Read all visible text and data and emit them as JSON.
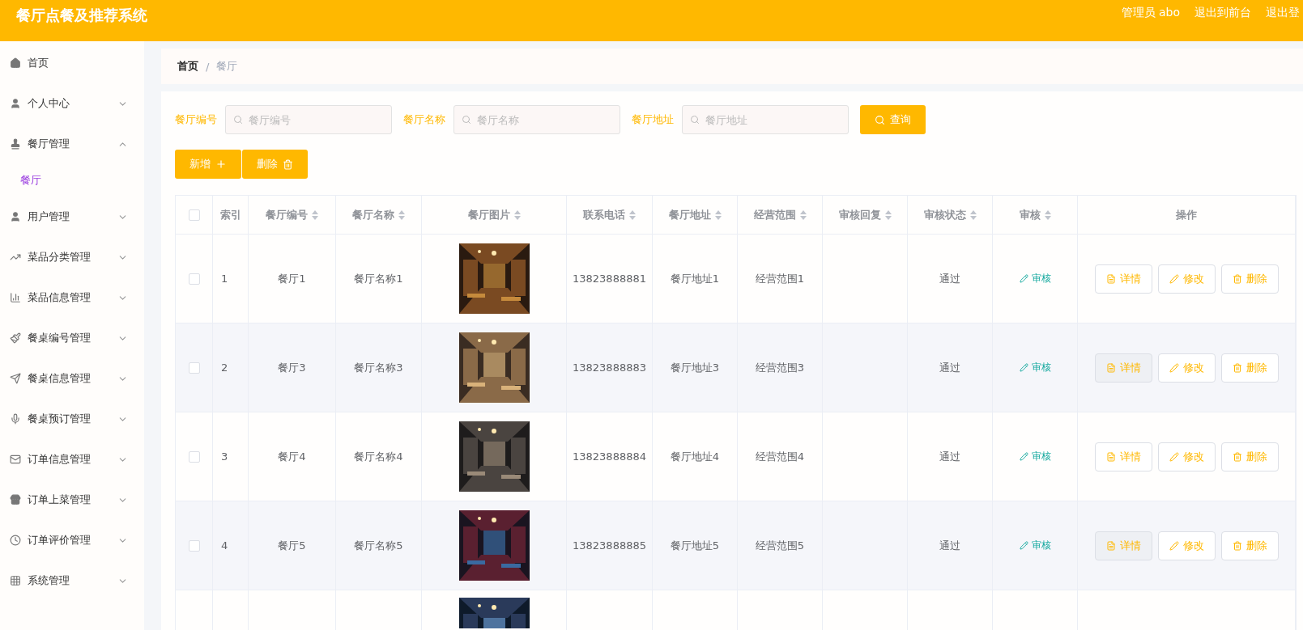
{
  "header": {
    "title": "餐厅点餐及推荐系统",
    "links": [
      "管理员 abo",
      "退出到前台",
      "退出登"
    ]
  },
  "sidebar": {
    "items": [
      {
        "label": "首页",
        "kind": "link"
      },
      {
        "label": "个人中心",
        "kind": "menu",
        "expanded": false
      },
      {
        "label": "餐厅管理",
        "kind": "menu",
        "expanded": true,
        "children": [
          {
            "label": "餐厅",
            "selected": true
          }
        ]
      },
      {
        "label": "用户管理",
        "kind": "menu",
        "expanded": false
      },
      {
        "label": "菜品分类管理",
        "kind": "menu",
        "expanded": false
      },
      {
        "label": "菜品信息管理",
        "kind": "menu",
        "expanded": false
      },
      {
        "label": "餐桌编号管理",
        "kind": "menu",
        "expanded": false
      },
      {
        "label": "餐桌信息管理",
        "kind": "menu",
        "expanded": false
      },
      {
        "label": "餐桌预订管理",
        "kind": "menu",
        "expanded": false
      },
      {
        "label": "订单信息管理",
        "kind": "menu",
        "expanded": false
      },
      {
        "label": "订单上菜管理",
        "kind": "menu",
        "expanded": false
      },
      {
        "label": "订单评价管理",
        "kind": "menu",
        "expanded": false
      },
      {
        "label": "系统管理",
        "kind": "menu",
        "expanded": false
      }
    ]
  },
  "breadcrumb": [
    "首页",
    "/",
    "餐厅"
  ],
  "search": {
    "fields": [
      {
        "label": "餐厅编号",
        "placeholder": "餐厅编号"
      },
      {
        "label": "餐厅名称",
        "placeholder": "餐厅名称"
      },
      {
        "label": "餐厅地址",
        "placeholder": "餐厅地址"
      }
    ],
    "button": "查询"
  },
  "actions": [
    {
      "label": "新增",
      "kind": "add"
    },
    {
      "label": "删除",
      "kind": "delete"
    }
  ],
  "table": {
    "select_all": {
      "checked": false
    },
    "columns": [
      "索引",
      "餐厅编号",
      "餐厅名称",
      "餐厅图片",
      "联系电话",
      "餐厅地址",
      "经营范围",
      "审核回复",
      "审核状态",
      "审核",
      "操作"
    ],
    "rows": [
      {
        "index": "1",
        "code": "餐厅1",
        "name": "餐厅名称1",
        "phone": "13823888881",
        "address": "餐厅地址1",
        "scope": "经营范围1",
        "status": "通过",
        "review": "审核",
        "buttons": [
          "详情",
          "修改",
          "删除"
        ],
        "checked": false
      },
      {
        "index": "2",
        "code": "餐厅3",
        "name": "餐厅名称3",
        "phone": "13823888883",
        "address": "餐厅地址3",
        "scope": "经营范围3",
        "status": "通过",
        "review": "审核",
        "buttons": [
          "详情",
          "修改",
          "删除"
        ],
        "checked": false
      },
      {
        "index": "3",
        "code": "餐厅4",
        "name": "餐厅名称4",
        "phone": "13823888884",
        "address": "餐厅地址4",
        "scope": "经营范围4",
        "status": "通过",
        "review": "审核",
        "buttons": [
          "详情",
          "修改",
          "删除"
        ],
        "checked": false
      },
      {
        "index": "4",
        "code": "餐厅5",
        "name": "餐厅名称5",
        "phone": "13823888885",
        "address": "餐厅地址5",
        "scope": "经营范围5",
        "status": "通过",
        "review": "审核",
        "buttons": [
          "详情",
          "修改",
          "删除"
        ],
        "checked": false
      }
    ]
  }
}
